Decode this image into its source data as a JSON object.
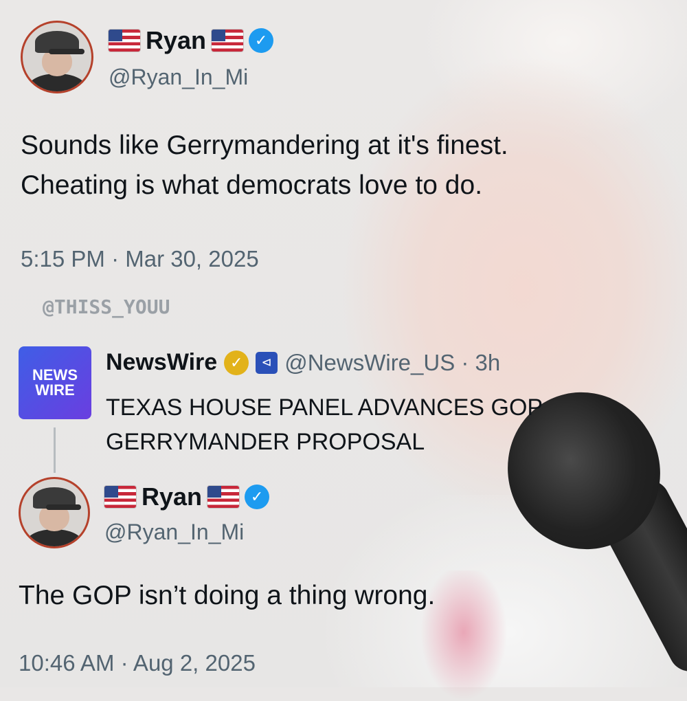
{
  "tweet1": {
    "display_name": "Ryan",
    "handle": "@Ryan_In_Mi",
    "text_line1": "Sounds like Gerrymandering at it's finest.",
    "text_line2": "Cheating is what democrats love to do.",
    "timestamp": "5:15 PM · Mar 30, 2025",
    "verified_icon": "blue-check",
    "flag_icon": "us-flag"
  },
  "watermark": "@THISS_YOUU",
  "quoted": {
    "logo_line1": "NEWS",
    "logo_line2": "WIRE",
    "display_name": "NewsWire",
    "verified_icon": "gold-check",
    "badge_icon": "news-badge",
    "handle_time": "@NewsWire_US · 3h",
    "headline_line1": "TEXAS HOUSE PANEL ADVANCES GOP",
    "headline_line2": "GERRYMANDER PROPOSAL"
  },
  "tweet2": {
    "display_name": "Ryan",
    "handle": "@Ryan_In_Mi",
    "text": "The GOP isn’t doing a thing wrong.",
    "timestamp": "10:46 AM · Aug 2, 2025",
    "verified_icon": "blue-check",
    "flag_icon": "us-flag"
  },
  "colors": {
    "text": "#0f1419",
    "secondary": "#536471",
    "verified_blue": "#1d9bf0",
    "verified_gold": "#e2b21a",
    "avatar_ring": "#b5412b"
  }
}
